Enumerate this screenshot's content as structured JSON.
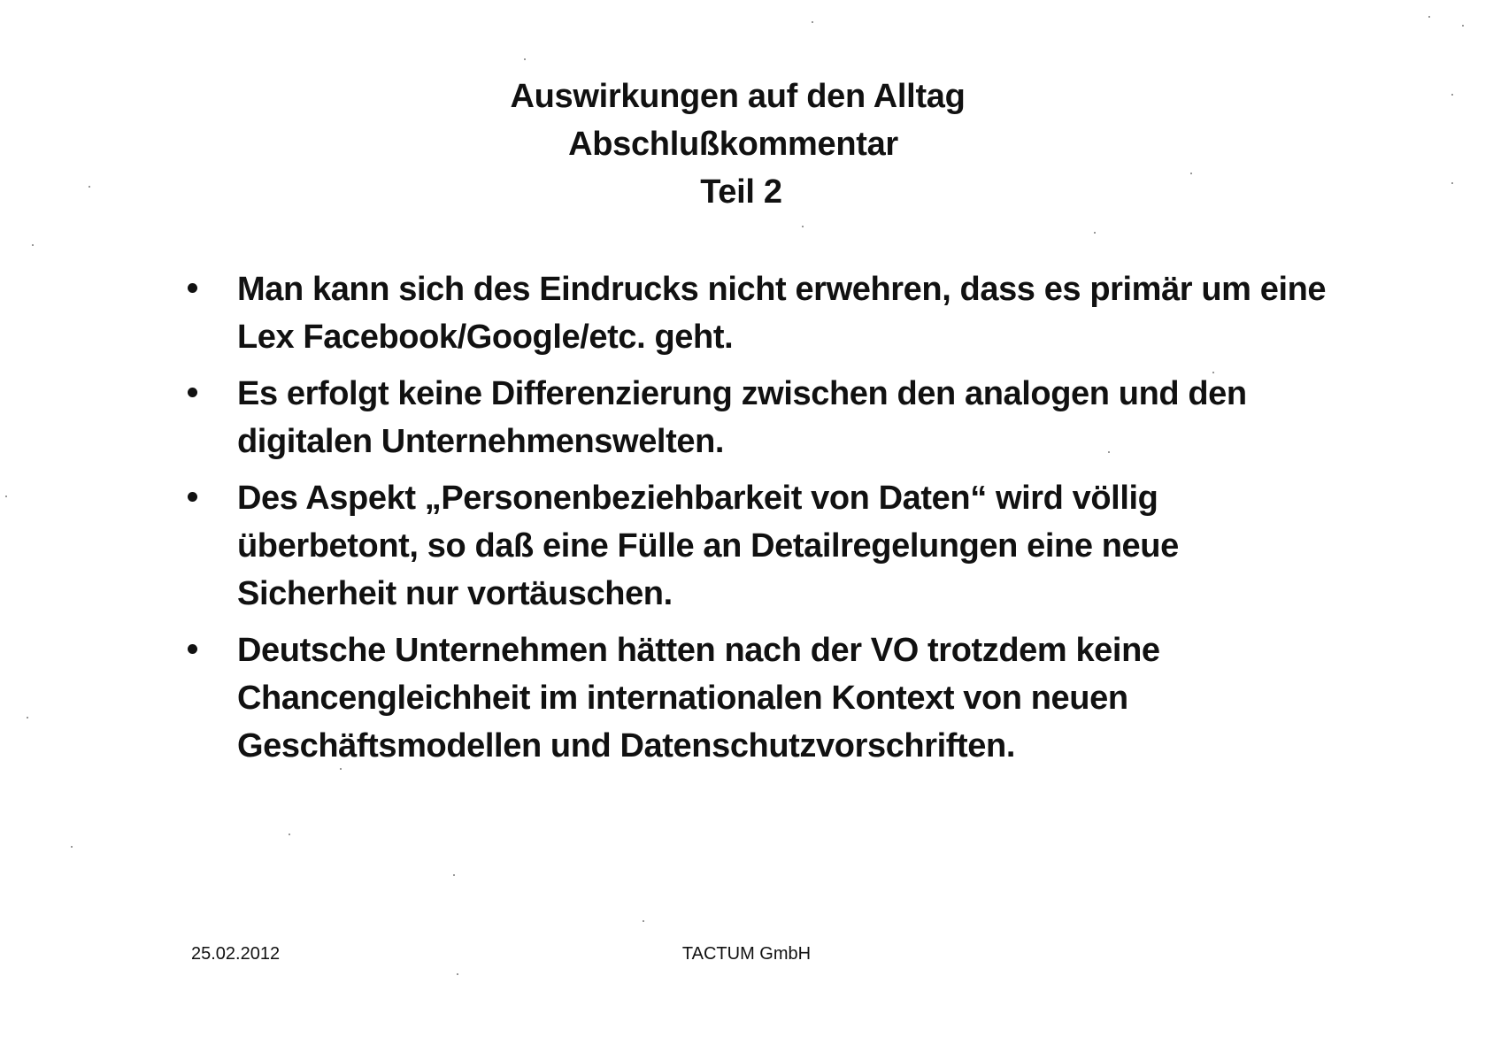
{
  "title": {
    "line1": "Auswirkungen auf den Alltag",
    "line2": "Abschlußkommentar",
    "line3": "Teil 2"
  },
  "bullets": [
    "Man kann sich des Eindrucks nicht erwehren, dass es primär um eine Lex Facebook/Google/etc. geht.",
    "Es erfolgt keine Differenzierung zwischen den analogen und den digitalen Unternehmenswelten.",
    "Des Aspekt „Personenbeziehbarkeit von Daten“ wird völlig überbetont, so daß eine Fülle an Detailregelungen eine neue Sicherheit nur vortäuschen.",
    "Deutsche Unternehmen hätten nach der VO trotzdem keine Chancengleichheit im internationalen Kontext von neuen Geschäftsmodellen und Datenschutzvorschriften."
  ],
  "footer": {
    "date": "25.02.2012",
    "company": "TACTUM GmbH"
  }
}
